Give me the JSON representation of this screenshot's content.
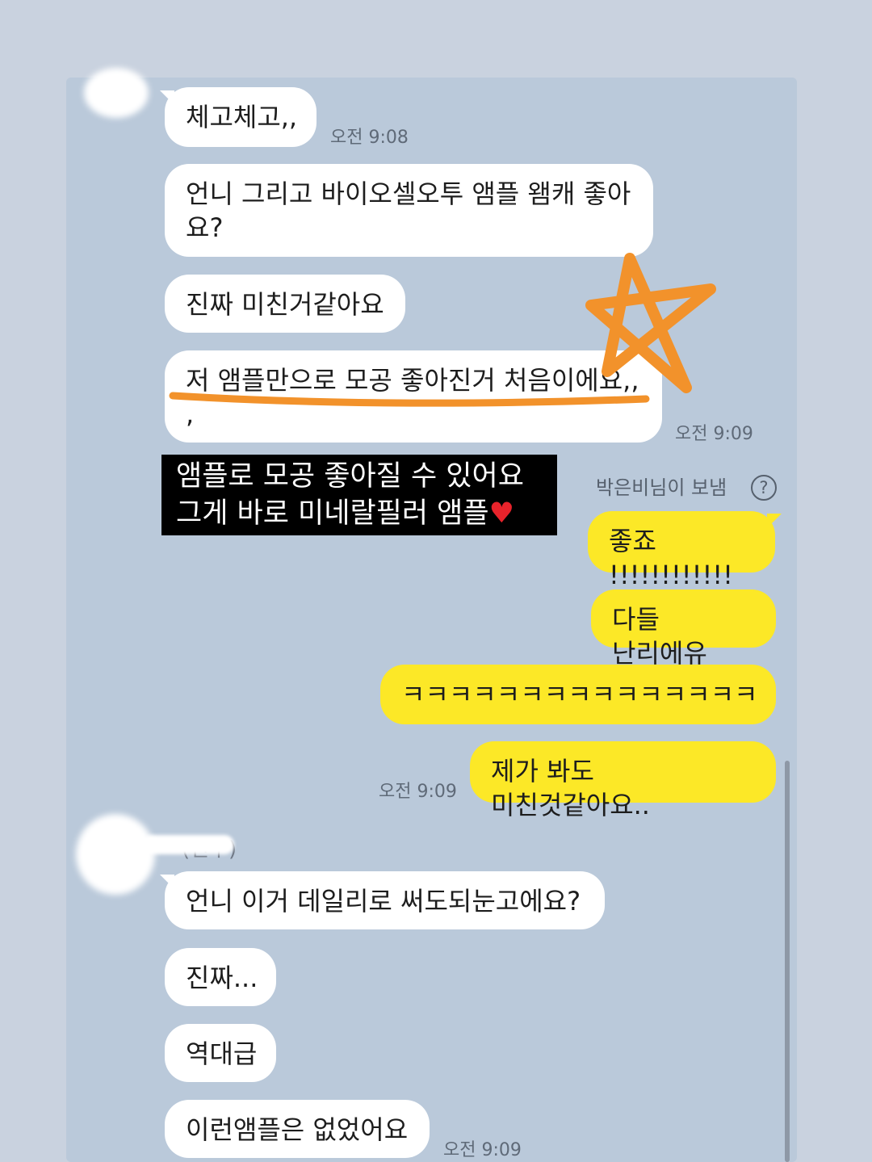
{
  "colors": {
    "chat_background": "#bac9da",
    "incoming_bubble": "#ffffff",
    "outgoing_bubble": "#fce827",
    "annotation_orange": "#f2922b"
  },
  "incoming_group_1": {
    "messages": [
      {
        "text": "체고체고,,"
      },
      {
        "text": "언니 그리고 바이오셀오투 앰플 왬캐 좋아\n요?"
      },
      {
        "text": "진짜 미친거같아요"
      },
      {
        "text": "저 앰플만으로 모공 좋아진거 처음이에요,,\n,"
      }
    ],
    "times": [
      "오전 9:08",
      "오전 9:09"
    ]
  },
  "overlay_caption": {
    "line1": "앰플로 모공 좋아질 수 있어요",
    "line2": "그게 바로 미네랄필러 앰플",
    "heart": "♥"
  },
  "outgoing_group": {
    "sent_by": "박은비님이 보냄",
    "help_icon": "?",
    "messages": [
      {
        "text": "좋죠 !!!!!!!!!!!!"
      },
      {
        "text": "다들 난리에유"
      },
      {
        "text": "ㅋㅋㅋㅋㅋㅋㅋㅋㅋㅋㅋㅋㅋㅋㅋ"
      },
      {
        "text": "제가 봐도 미친것같아요.."
      }
    ],
    "time": "오전 9:09"
  },
  "incoming_group_2": {
    "sender_name": "(친구)",
    "messages": [
      {
        "text": "언니 이거 데일리로 써도되눈고에요?"
      },
      {
        "text": "진짜..."
      },
      {
        "text": "역대급"
      },
      {
        "text": "이런앰플은 없었어요"
      }
    ],
    "time": "오전 9:09"
  }
}
